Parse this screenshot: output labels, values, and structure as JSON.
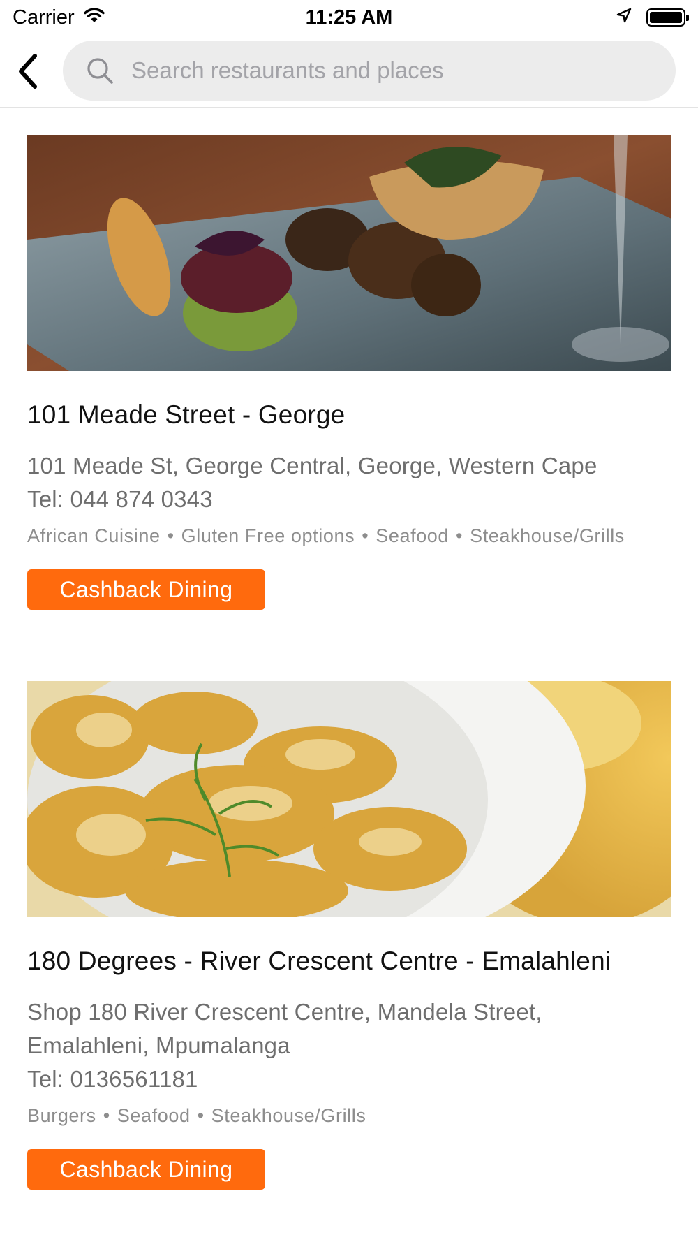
{
  "status_bar": {
    "carrier": "Carrier",
    "time": "11:25 AM"
  },
  "search": {
    "placeholder": "Search restaurants and places",
    "value": ""
  },
  "restaurants": [
    {
      "name": "101 Meade Street - George",
      "address": "101 Meade St, George Central, George, Western Cape",
      "tel": "Tel: 044 874 0343",
      "tags": [
        "African Cuisine",
        "Gluten Free options",
        "Seafood",
        "Steakhouse/Grills"
      ],
      "button_label": "Cashback Dining"
    },
    {
      "name": "180 Degrees - River Crescent Centre - Emalahleni",
      "address": "Shop 180 River Crescent Centre, Mandela Street, Emalahleni, Mpumalanga",
      "tel": "Tel: 0136561181",
      "tags": [
        "Burgers",
        "Seafood",
        "Steakhouse/Grills"
      ],
      "button_label": "Cashback Dining"
    }
  ],
  "colors": {
    "accent": "#ff6a0d",
    "secondary_text": "#6e6e6e",
    "search_bg": "#ececec"
  },
  "icons": {
    "back": "chevron-left-icon",
    "search": "search-icon",
    "wifi": "wifi-icon",
    "location": "location-arrow-icon",
    "battery": "battery-icon"
  }
}
